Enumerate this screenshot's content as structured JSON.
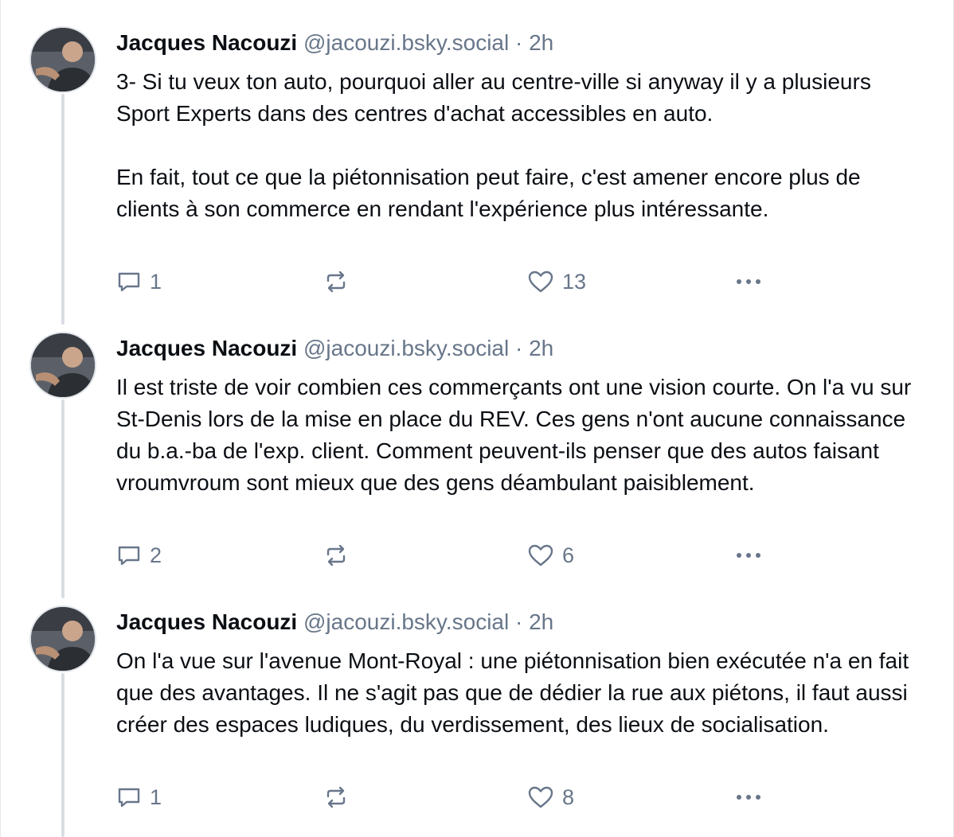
{
  "posts": [
    {
      "author": {
        "name": "Jacques Nacouzi",
        "handle": "@jacouzi.bsky.social",
        "separator": "·",
        "time": "2h"
      },
      "paragraphs": [
        "3- Si tu veux ton auto, pourquoi aller au centre-ville si anyway il y a plusieurs Sport Experts dans des centres d'achat accessibles en auto.",
        "En fait, tout ce que la piétonnisation peut faire, c'est amener encore plus de clients à son commerce en rendant l'expérience plus intéressante."
      ],
      "stats": {
        "replies": "1",
        "reposts": "",
        "likes": "13"
      }
    },
    {
      "author": {
        "name": "Jacques Nacouzi",
        "handle": "@jacouzi.bsky.social",
        "separator": "·",
        "time": "2h"
      },
      "paragraphs": [
        "Il est triste de voir combien ces commerçants ont une vision courte. On l'a vu sur St-Denis lors de la mise en place du REV. Ces gens n'ont aucune connaissance du b.a.-ba de l'exp. client. Comment peuvent-ils penser que des autos faisant vroumvroum sont mieux que des gens déambulant paisiblement."
      ],
      "stats": {
        "replies": "2",
        "reposts": "",
        "likes": "6"
      }
    },
    {
      "author": {
        "name": "Jacques Nacouzi",
        "handle": "@jacouzi.bsky.social",
        "separator": "·",
        "time": "2h"
      },
      "paragraphs": [
        "On l'a vue sur l'avenue Mont-Royal : une piétonnisation bien exécutée n'a en fait que des avantages. Il ne s'agit pas que de dédier la rue aux piétons, il faut aussi créer des espaces ludiques, du verdissement, des lieux de socialisation."
      ],
      "stats": {
        "replies": "1",
        "reposts": "",
        "likes": "8"
      }
    }
  ],
  "icons": {
    "reply": "speech-bubble-icon",
    "repost": "repost-arrows-icon",
    "like": "heart-outline-icon",
    "more": "ellipsis-icon"
  },
  "colors": {
    "text": "#0b0f14",
    "muted": "#68768a",
    "thread_line": "#d9dde3"
  }
}
